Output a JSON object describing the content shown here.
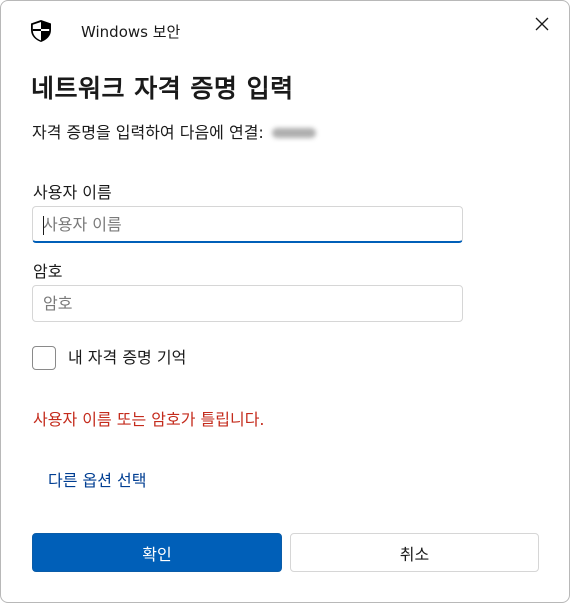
{
  "window": {
    "app_title": "Windows 보안",
    "icon": "shield-icon",
    "close_icon": "close-icon"
  },
  "dialog": {
    "heading": "네트워크 자격 증명 입력",
    "subtitle": "자격 증명을 입력하여 다음에 연결:"
  },
  "username": {
    "label": "사용자 이름",
    "placeholder": "사용자 이름",
    "value": ""
  },
  "password": {
    "label": "암호",
    "placeholder": "암호",
    "value": ""
  },
  "remember": {
    "label": "내 자격 증명 기억",
    "checked": false
  },
  "error_message": "사용자 이름 또는 암호가 틀립니다.",
  "more_options_link": "다른 옵션 선택",
  "buttons": {
    "ok_label": "확인",
    "cancel_label": "취소"
  },
  "colors": {
    "accent": "#005fb8",
    "error": "#c42b1c",
    "link": "#003e92"
  }
}
